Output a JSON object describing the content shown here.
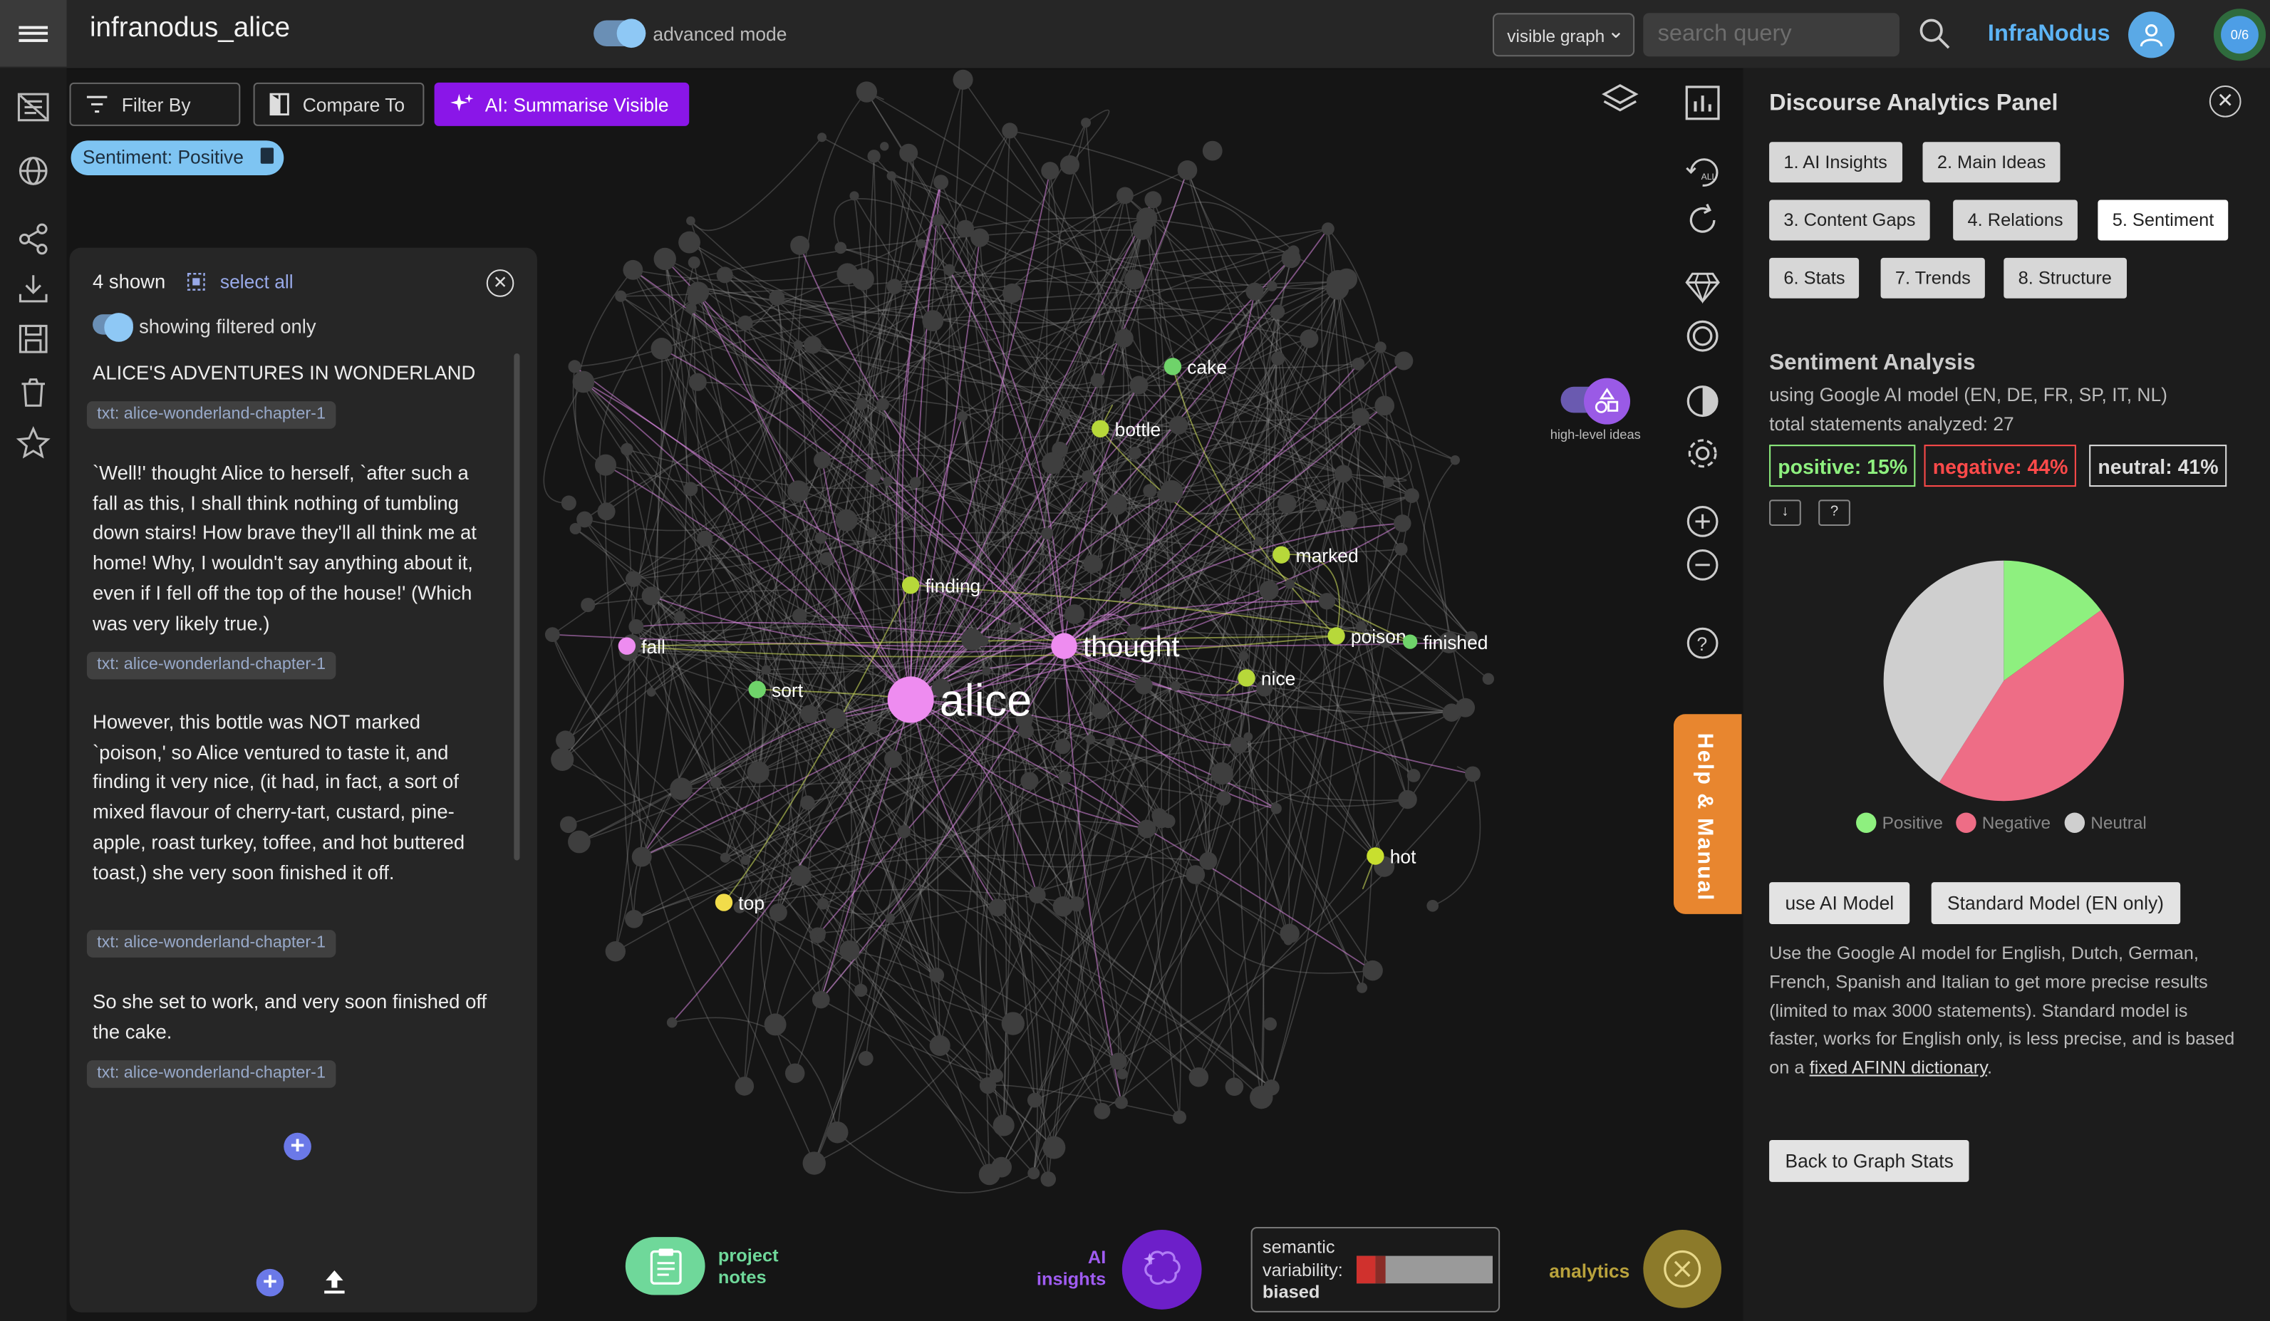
{
  "topbar": {
    "app_title": "infranodus_alice",
    "advanced_mode_label": "advanced mode",
    "graph_view_select": "visible graph",
    "search_placeholder": "search query",
    "brand": "InfraNodus",
    "counter": "0/6"
  },
  "toolbar": {
    "filter_by": "Filter By",
    "compare_to": "Compare To",
    "ai_summarise": "AI: Summarise Visible",
    "active_filter_chip": "Sentiment: Positive"
  },
  "statements_panel": {
    "shown_count": "4 shown",
    "select_all": "select all",
    "showing_filtered": "showing filtered only",
    "statements": [
      {
        "text": "ALICE'S ADVENTURES IN WONDERLAND",
        "tag": "txt: alice-wonderland-chapter-1"
      },
      {
        "text": "`Well!' thought Alice to herself, `after such a fall as this, I shall think nothing of tumbling down stairs! How brave they'll all think me at home! Why, I wouldn't say anything about it, even if I fell off the top of the house!' (Which was very likely true.)",
        "tag": "txt: alice-wonderland-chapter-1"
      },
      {
        "text": "However, this bottle was NOT marked `poison,' so Alice ventured to taste it, and finding it very nice, (it had, in fact, a sort of mixed flavour of cherry-tart, custard, pine-apple, roast turkey, toffee, and hot buttered toast,) she very soon finished it off.",
        "tag": "txt: alice-wonderland-chapter-1"
      },
      {
        "text": "So she set to work, and very soon finished off the cake.",
        "tag": "txt: alice-wonderland-chapter-1"
      }
    ]
  },
  "graph": {
    "high_level_ideas_label": "high-level ideas",
    "nodes": [
      {
        "label": "alice",
        "color": "#ee8cf0"
      },
      {
        "label": "thought",
        "color": "#ee8cf0"
      },
      {
        "label": "fall",
        "color": "#ee8cf0"
      },
      {
        "label": "sort",
        "color": "#6fd36a"
      },
      {
        "label": "finding",
        "color": "#b7d83a"
      },
      {
        "label": "bottle",
        "color": "#b7d83a"
      },
      {
        "label": "cake",
        "color": "#6fd36a"
      },
      {
        "label": "marked",
        "color": "#b7d83a"
      },
      {
        "label": "poison",
        "color": "#b7d83a"
      },
      {
        "label": "finished",
        "color": "#6fd36a"
      },
      {
        "label": "nice",
        "color": "#b7d83a"
      },
      {
        "label": "hot",
        "color": "#c8df2f"
      },
      {
        "label": "top",
        "color": "#f1dc4a"
      }
    ]
  },
  "help_tab": "Help & Manual",
  "analytics_panel": {
    "title": "Discourse Analytics Panel",
    "tabs": [
      "1. AI Insights",
      "2. Main Ideas",
      "3. Content Gaps",
      "4. Relations",
      "5. Sentiment",
      "6. Stats",
      "7. Trends",
      "8. Structure"
    ],
    "active_tab": "5. Sentiment",
    "sentiment_title": "Sentiment Analysis",
    "model_line": "using Google AI model (EN, DE, FR, SP, IT, NL)",
    "total_line": "total statements analyzed: 27",
    "positive": "positive: 15%",
    "negative": "negative: 44%",
    "neutral": "neutral: 41%",
    "download_btn": "↓",
    "help_btn": "?",
    "use_ai_model": "use AI Model",
    "standard_model": "Standard Model (EN only)",
    "description_before_link": "Use the Google AI model for English, Dutch, German, French, Spanish and Italian to get more precise results (limited to max 3000 statements). Standard model is faster, works for English only, is less precise, and is based on a ",
    "description_link": "fixed AFINN dictionary",
    "description_after_link": ".",
    "back_button": "Back to Graph Stats"
  },
  "chart_data": {
    "type": "pie",
    "categories": [
      "Positive",
      "Negative",
      "Neutral"
    ],
    "values": [
      15,
      44,
      41
    ],
    "colors": [
      "#8ef07f",
      "#ee6d86",
      "#cfcfcf"
    ],
    "legend": "bottom"
  },
  "bottom_bar": {
    "project_notes": "project\nnotes",
    "ai_insights": "AI\ninsights",
    "semantic_label": "semantic\nvariability:",
    "semantic_value": "biased",
    "analytics": "analytics"
  },
  "colors": {
    "accent_purple": "#8a16e8",
    "brand_blue": "#5db4f5",
    "help_orange": "#e8862f",
    "positive_green": "#8ef07f",
    "negative_red": "#ee6d86",
    "neutral_gray": "#cfcfcf"
  }
}
